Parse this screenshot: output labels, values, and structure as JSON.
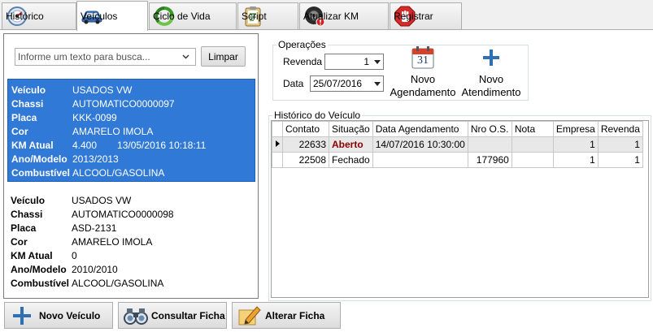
{
  "tabs": [
    {
      "label": "Histórico",
      "icon": "speedometer-icon",
      "active": false
    },
    {
      "label": "Veículos",
      "icon": "car-icon",
      "active": true
    },
    {
      "label": "Ciclo de Vida",
      "icon": "recycle-icon",
      "active": false
    },
    {
      "label": "Script",
      "icon": "clipboard-icon",
      "active": false
    },
    {
      "label": "Atualizar KM",
      "icon": "tire-alert-icon",
      "active": false
    },
    {
      "label": "Registrar",
      "icon": "stop-hand-icon",
      "active": false
    }
  ],
  "search": {
    "placeholder": "Informe um texto para busca...",
    "clear_label": "Limpar"
  },
  "vehicles": [
    {
      "selected": true,
      "rows": [
        {
          "label": "Veículo",
          "value": "USADOS VW",
          "extra": ""
        },
        {
          "label": "Chassi",
          "value": "AUTOMATICO0000097",
          "extra": ""
        },
        {
          "label": "Placa",
          "value": "KKK-0099",
          "extra": ""
        },
        {
          "label": "Cor",
          "value": "AMARELO IMOLA",
          "extra": ""
        },
        {
          "label": "KM Atual",
          "value": "4.400",
          "extra": "13/05/2016 10:18:11"
        },
        {
          "label": "Ano/Modelo",
          "value": "2013/2013",
          "extra": ""
        },
        {
          "label": "Combustível",
          "value": "ALCOOL/GASOLINA",
          "extra": ""
        }
      ]
    },
    {
      "selected": false,
      "rows": [
        {
          "label": "Veículo",
          "value": "USADOS VW",
          "extra": ""
        },
        {
          "label": "Chassi",
          "value": "AUTOMATICO0000098",
          "extra": ""
        },
        {
          "label": "Placa",
          "value": "ASD-2131",
          "extra": ""
        },
        {
          "label": "Cor",
          "value": "AMARELO IMOLA",
          "extra": ""
        },
        {
          "label": "KM Atual",
          "value": "0",
          "extra": ""
        },
        {
          "label": "Ano/Modelo",
          "value": "2010/2010",
          "extra": ""
        },
        {
          "label": "Combustível",
          "value": "ALCOOL/GASOLINA",
          "extra": ""
        }
      ]
    }
  ],
  "bottom_buttons": {
    "novo_veiculo": "Novo Veículo",
    "consultar_ficha": "Consultar Ficha",
    "alterar_ficha": "Alterar Ficha"
  },
  "operacoes": {
    "title": "Operações",
    "revenda_label": "Revenda",
    "revenda_value": "1",
    "data_label": "Data",
    "data_value": "25/07/2016",
    "calendar_day": "31",
    "novo_agendamento": [
      "Novo",
      "Agendamento"
    ],
    "novo_atendimento": [
      "Novo",
      "Atendimento"
    ]
  },
  "historico": {
    "title": "Histórico do Veículo",
    "columns": [
      "Contato",
      "Situação",
      "Data Agendamento",
      "Nro O.S.",
      "Nota",
      "Empresa",
      "Revenda"
    ],
    "rows": [
      {
        "contato": "22633",
        "situacao": "Aberto",
        "data": "14/07/2016 10:30:00",
        "os": "",
        "nota": "",
        "empresa": "1",
        "revenda": "1",
        "current": true
      },
      {
        "contato": "22508",
        "situacao": "Fechado",
        "data": "",
        "os": "177960",
        "nota": "",
        "empresa": "1",
        "revenda": "1",
        "current": false
      }
    ]
  },
  "colors": {
    "selection": "#3079d6",
    "status_open": "#8b0000",
    "accent_blue": "#2f6fb5"
  }
}
